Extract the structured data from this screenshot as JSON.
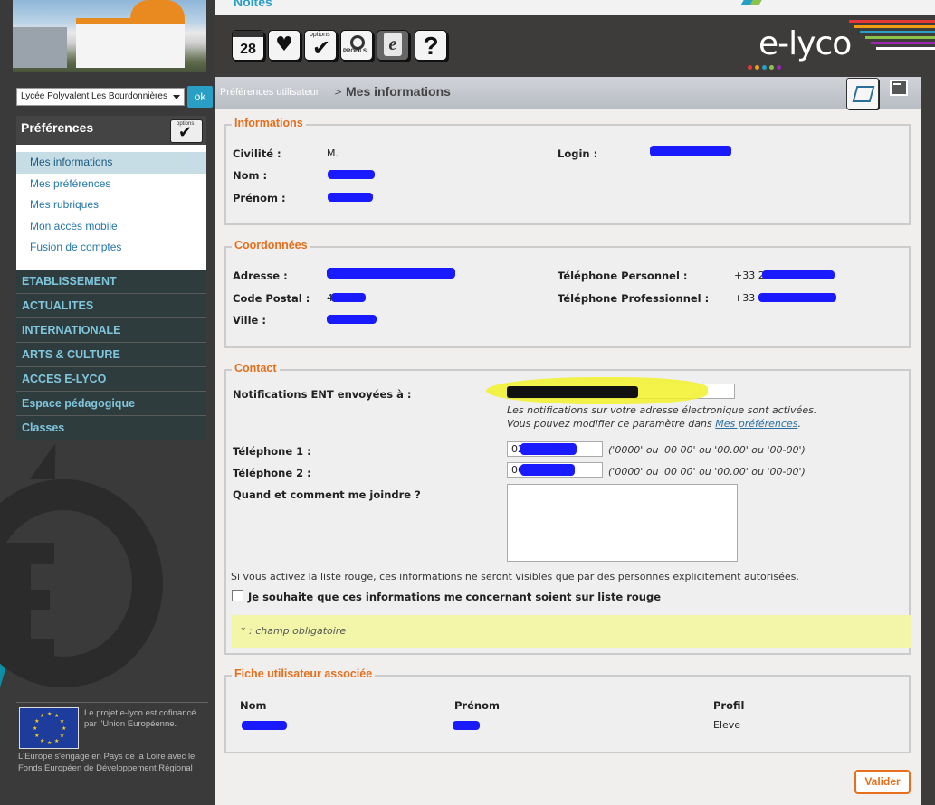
{
  "sidebar": {
    "school_select": "Lycée Polyvalent Les Bourdonnières",
    "ok_label": "ok",
    "prefs_title": "Préférences",
    "prefs_icon_label": "options",
    "pref_items": [
      "Mes informations",
      "Mes préférences",
      "Mes rubriques",
      "Mon accès mobile",
      "Fusion de comptes"
    ],
    "nav_items": [
      "ETABLISSEMENT",
      "ACTUALITES",
      "INTERNATIONALE",
      "ARTS & CULTURE",
      "ACCES E-LYCO",
      "Espace pédagogique",
      "Classes"
    ],
    "eu_text1": "Le projet e-lyco est cofinancé par l'Union Européenne.",
    "eu_text2": "L'Europe s'engage en Pays de la Loire avec le Fonds Européen de Développement Régional"
  },
  "topbar": {
    "strip_title": "Noites",
    "calendar_day": "28",
    "options_label": "options",
    "profil_label": "PROFILS",
    "ent_letter": "e",
    "help_glyph": "?",
    "logo_text": "e-lyco",
    "logo_colors": [
      "#e53935",
      "#f39c12",
      "#2a9fc5",
      "#8bc34a",
      "#9c27b0",
      "#ffffff"
    ]
  },
  "breadcrumb": {
    "parent": "Préférences utilisateur",
    "separator": ">",
    "current": "Mes informations"
  },
  "informations": {
    "legend": "Informations",
    "civilite_label": "Civilité :",
    "civilite_value": "M.",
    "nom_label": "Nom :",
    "prenom_label": "Prénom :",
    "login_label": "Login :"
  },
  "coordonnees": {
    "legend": "Coordonnées",
    "adresse_label": "Adresse :",
    "cp_label": "Code Postal :",
    "cp_value": "4",
    "ville_label": "Ville :",
    "tel_perso_label": "Téléphone Personnel :",
    "tel_perso_value": "+33 2",
    "tel_pro_label": "Téléphone Professionnel :",
    "tel_pro_value": "+33"
  },
  "contact": {
    "legend": "Contact",
    "notif_label": "Notifications ENT envoyées à :",
    "notif_hint1": "Les notifications sur votre adresse électronique sont activées.",
    "notif_hint2_prefix": "Vous pouvez modifier ce paramètre dans ",
    "notif_hint2_link": "Mes préférences",
    "notif_hint2_suffix": ".",
    "tel1_label": "Téléphone 1 :",
    "tel1_value": "02",
    "tel2_label": "Téléphone 2 :",
    "tel2_value": "06",
    "tel_format_hint": "('0000' ou '00 00' ou '00.00' ou '00-00')",
    "joindre_label": "Quand et comment me joindre ?",
    "liste_rouge_info": "Si vous activez la liste rouge, ces informations ne seront visibles que par des personnes explicitement autorisées.",
    "liste_rouge_checkbox": "Je souhaite que ces informations me concernant soient sur liste rouge",
    "champ_obligatoire": "* : champ obligatoire"
  },
  "fiche": {
    "legend": "Fiche utilisateur associée",
    "col_nom": "Nom",
    "col_prenom": "Prénom",
    "col_profil": "Profil",
    "profil_value": "Eleve"
  },
  "actions": {
    "valider": "Valider"
  }
}
